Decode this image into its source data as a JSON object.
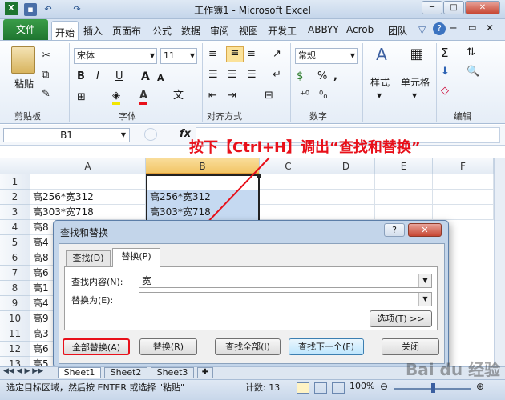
{
  "window": {
    "title": "工作簿1 - Microsoft Excel",
    "controls": [
      "─",
      "□",
      "✕"
    ]
  },
  "quick_access": {
    "save_icon": "save-icon",
    "undo": "↶",
    "redo": "↷"
  },
  "tabs": {
    "file": "文件",
    "items": [
      "开始",
      "插入",
      "页面布",
      "公式",
      "数据",
      "审阅",
      "视图",
      "开发工",
      "ABBYY",
      "Acrob",
      "团队"
    ]
  },
  "ribbon": {
    "clipboard": {
      "paste": "粘贴",
      "label": "剪贴板"
    },
    "font": {
      "name": "宋体",
      "size": "11",
      "label": "字体",
      "bold": "B",
      "italic": "I",
      "underline": "U",
      "grow": "A",
      "shrink": "A"
    },
    "alignment": {
      "label": "对齐方式"
    },
    "number": {
      "format": "常规",
      "label": "数字",
      "percent": "%",
      "comma": ","
    },
    "styles": {
      "label": "样式"
    },
    "cells": {
      "label": "单元格"
    },
    "editing": {
      "label": "编辑",
      "sum": "Σ"
    }
  },
  "formula_bar": {
    "name_box": "B1",
    "fx": "fx",
    "value": ""
  },
  "annotation": "按下【Ctrl+H】调出“查找和替换”",
  "grid": {
    "columns": [
      "A",
      "B",
      "C",
      "D",
      "E",
      "F"
    ],
    "rows": [
      "1",
      "2",
      "3",
      "4",
      "5",
      "6",
      "7",
      "8",
      "9",
      "10",
      "11",
      "12",
      "13"
    ],
    "col_a": [
      "",
      "高256*宽312",
      "高303*宽718",
      "高8",
      "高4",
      "高8",
      "高6",
      "高1",
      "高4",
      "高9",
      "高3",
      "高6",
      "高5"
    ],
    "col_b": [
      "",
      "高256*宽312",
      "高303*宽718"
    ]
  },
  "dialog": {
    "title": "查找和替换",
    "help": "?",
    "close": "✕",
    "tab_find": "查找(D)",
    "tab_replace": "替换(P)",
    "find_label": "查找内容(N):",
    "find_value": "宽",
    "replace_label": "替换为(E):",
    "replace_value": "",
    "options": "选项(T) >>",
    "btn_replace_all": "全部替换(A)",
    "btn_replace": "替换(R)",
    "btn_find_all": "查找全部(I)",
    "btn_find_next": "查找下一个(F)",
    "btn_close": "关闭"
  },
  "sheets": [
    "Sheet1",
    "Sheet2",
    "Sheet3"
  ],
  "status": {
    "message": "选定目标区域，然后按 ENTER 或选择 \"粘贴\"",
    "count": "计数: 13",
    "zoom": "100%"
  },
  "watermark": "Bai du 经验",
  "colors": {
    "accent": "#1e7530",
    "annotation": "#e8101a",
    "selection": "#c5d9f1"
  }
}
